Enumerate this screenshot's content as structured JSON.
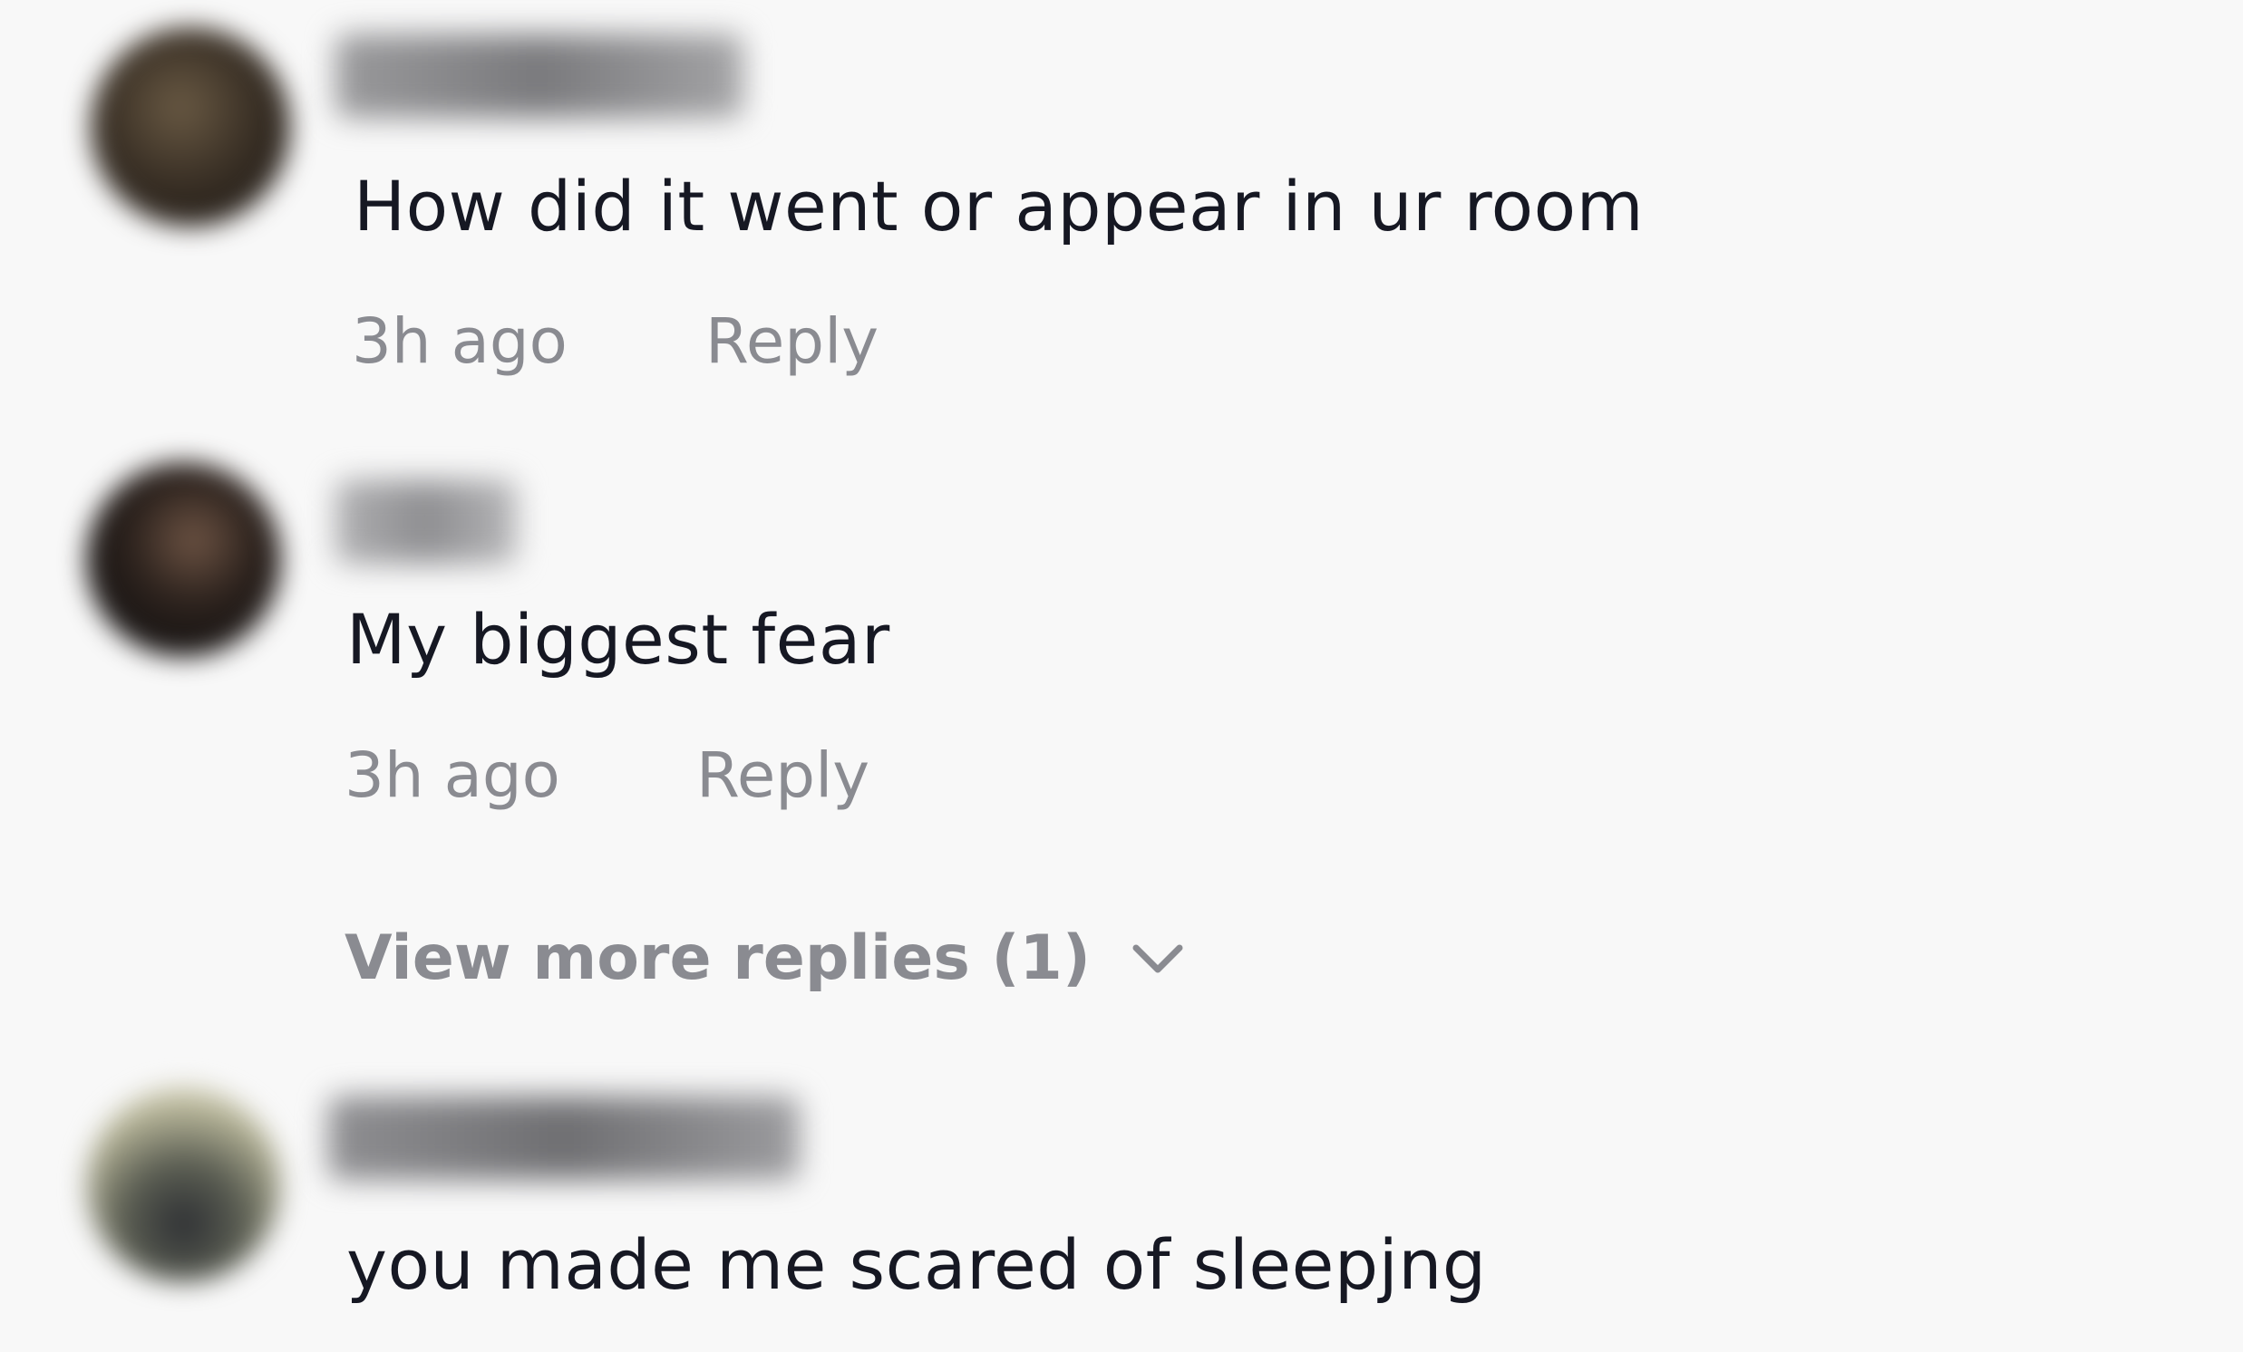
{
  "comments": [
    {
      "text": "How did it went or appear in ur room",
      "time": "3h ago",
      "reply_label": "Reply"
    },
    {
      "text": "My biggest fear",
      "time": "3h ago",
      "reply_label": "Reply",
      "view_more_label": "View more replies (1)"
    },
    {
      "text": "you made me scared of sleepjng"
    }
  ],
  "colors": {
    "background": "#f8f8f8",
    "text_primary": "#161823",
    "text_secondary": "#8a8b91"
  },
  "icons": {
    "expand": "chevron-down-icon"
  }
}
